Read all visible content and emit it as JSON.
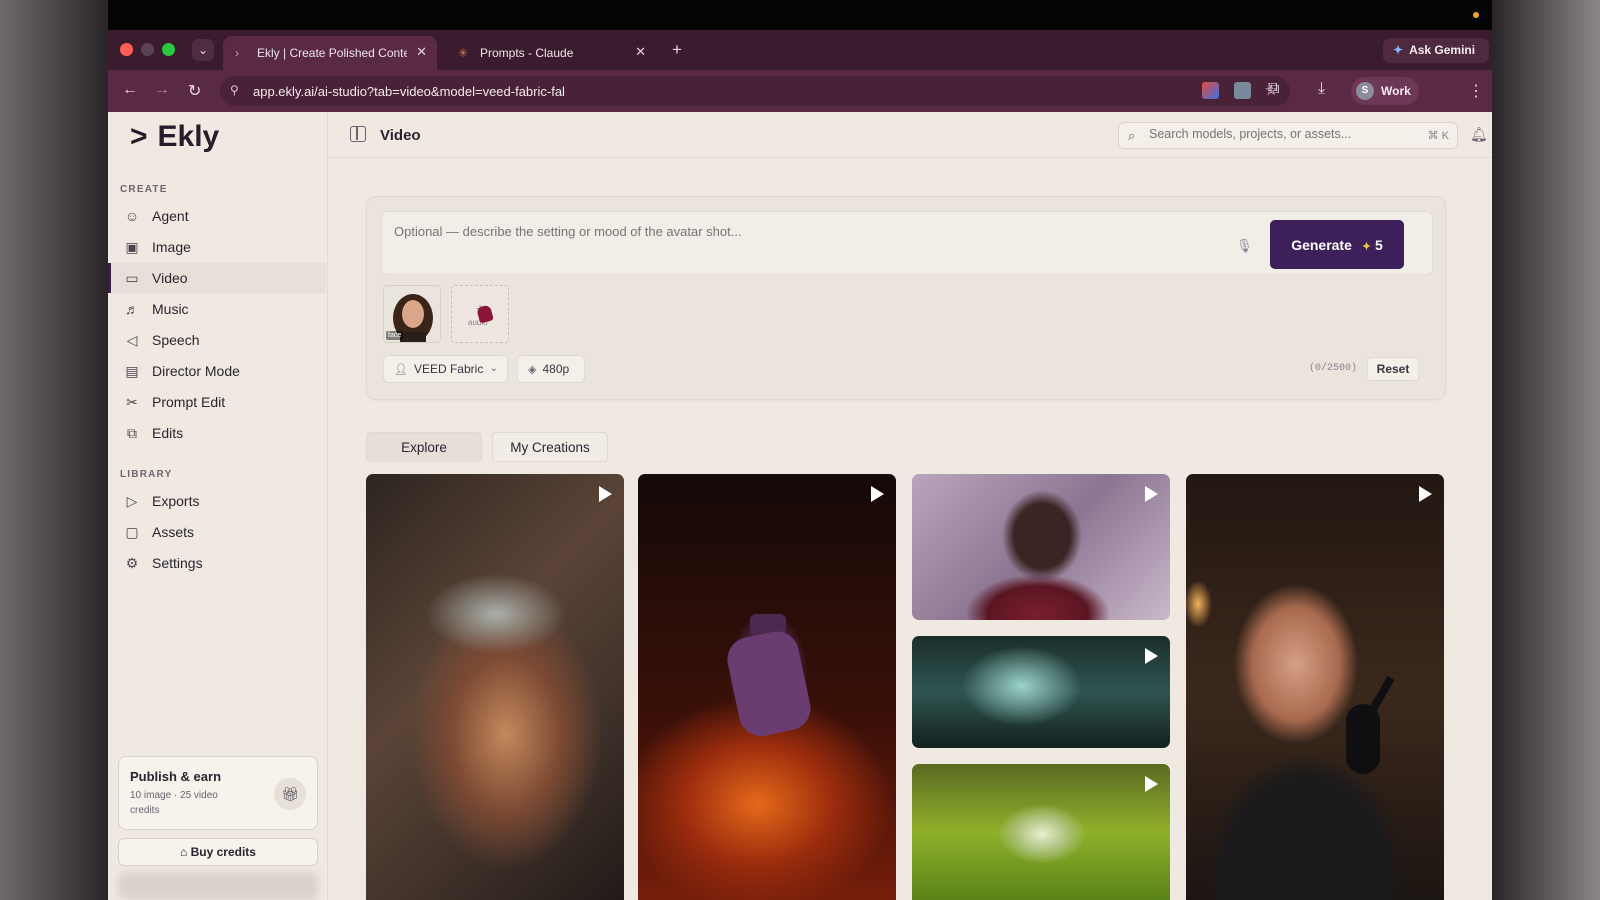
{
  "browser": {
    "tabs": [
      {
        "title": "Ekly | Create Polished Content",
        "favicon": "ekly-chevron",
        "active": true
      },
      {
        "title": "Prompts - Claude",
        "favicon": "claude-asterisk",
        "active": false
      }
    ],
    "url": "app.ekly.ai/ai-studio?tab=video&model=veed-fabric-fal",
    "ask_gemini": "Ask Gemini",
    "profile": {
      "initial": "S",
      "name": "Work"
    }
  },
  "sidebar": {
    "logo": "Ekly",
    "create_label": "CREATE",
    "create_items": [
      {
        "label": "Agent",
        "icon": "robot-icon",
        "glyph": "☺"
      },
      {
        "label": "Image",
        "icon": "image-icon",
        "glyph": "▣"
      },
      {
        "label": "Video",
        "icon": "video-icon",
        "glyph": "▭",
        "active": true
      },
      {
        "label": "Music",
        "icon": "music-icon",
        "glyph": "♬"
      },
      {
        "label": "Speech",
        "icon": "speaker-icon",
        "glyph": "◁"
      },
      {
        "label": "Director Mode",
        "icon": "clapper-icon",
        "glyph": "▤"
      },
      {
        "label": "Prompt Edit",
        "icon": "scissors-icon",
        "glyph": "✂"
      },
      {
        "label": "Edits",
        "icon": "layers-icon",
        "glyph": "⧉"
      }
    ],
    "library_label": "LIBRARY",
    "library_items": [
      {
        "label": "Exports",
        "icon": "play-outline-icon",
        "glyph": "▷"
      },
      {
        "label": "Assets",
        "icon": "archive-icon",
        "glyph": "▢"
      },
      {
        "label": "Settings",
        "icon": "gear-icon",
        "glyph": "⚙"
      }
    ],
    "publish": {
      "title": "Publish & earn",
      "subtitle": "10 image · 25 video credits"
    },
    "buy_credits": "Buy credits"
  },
  "header": {
    "title": "Video",
    "search_placeholder": "Search models, projects, or assets...",
    "search_shortcut": "⌘ K"
  },
  "composer": {
    "placeholder": "Optional — describe the setting or mood of the avatar shot...",
    "generate_label": "Generate",
    "generate_cost": "5",
    "face_tag": "face",
    "audio_label": "audio",
    "model": "VEED Fabric",
    "resolution": "480p",
    "char_count": "(0/2500)",
    "reset_label": "Reset"
  },
  "gallery_tabs": {
    "explore": "Explore",
    "my_creations": "My Creations"
  },
  "gallery": [
    {
      "subject": "warrior woman with painted face"
    },
    {
      "subject": "purple perfume bottle with flames"
    },
    {
      "subject": "woman in red coat, purple backdrop"
    },
    {
      "subject": "figure in misty forest"
    },
    {
      "subject": "water droplet on green leaf"
    },
    {
      "subject": "man speaking into microphone"
    }
  ],
  "colors": {
    "accent": "#3d1f5a",
    "browser_frame": "#5a2a44",
    "app_bg": "#efe9e1"
  }
}
